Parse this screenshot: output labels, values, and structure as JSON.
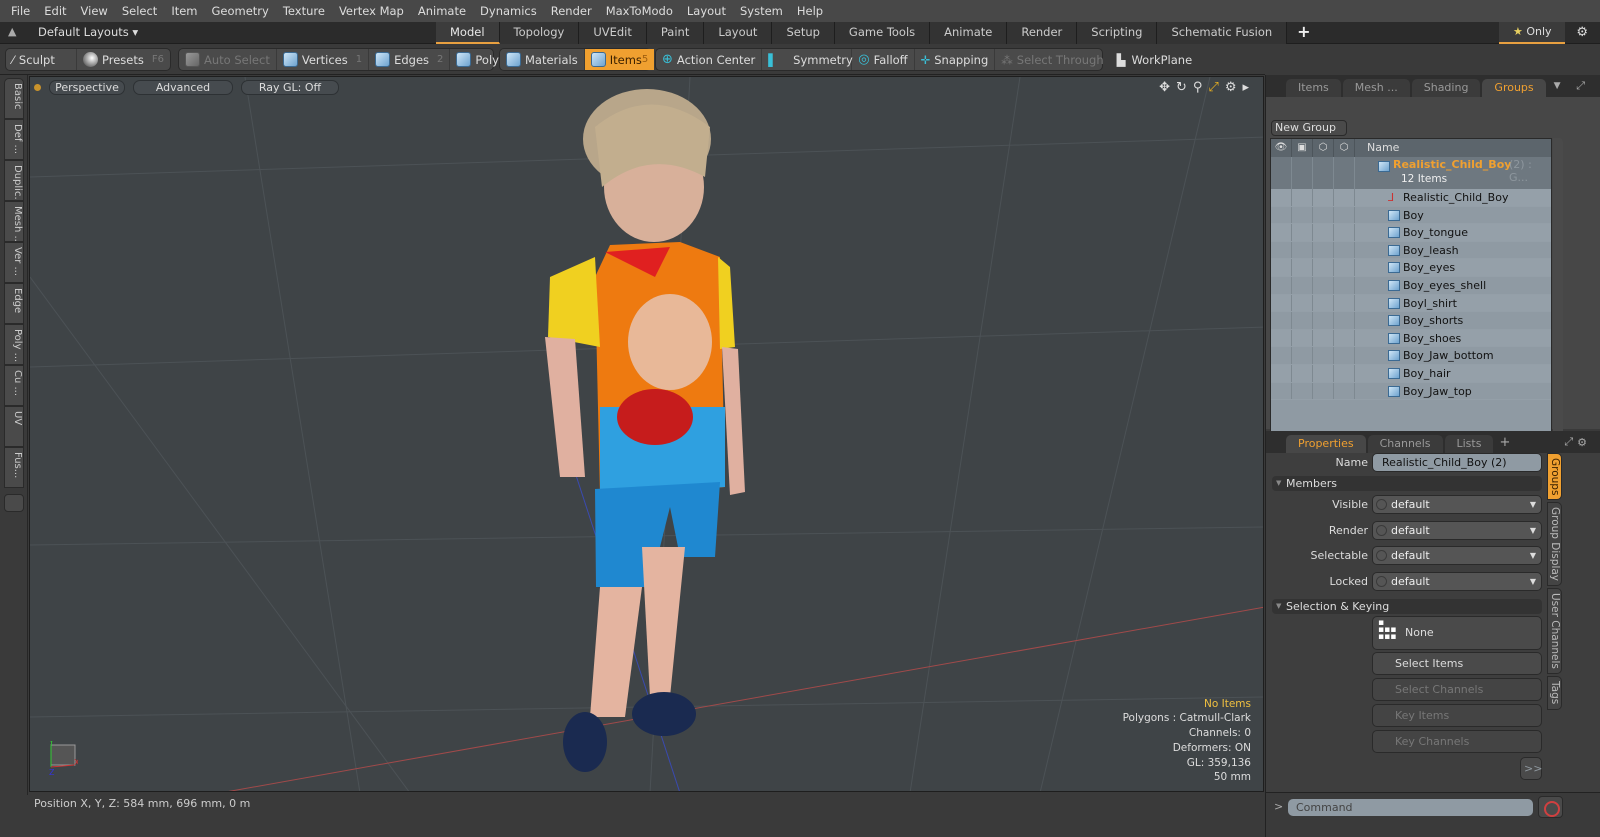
{
  "menu": [
    "File",
    "Edit",
    "View",
    "Select",
    "Item",
    "Geometry",
    "Texture",
    "Vertex Map",
    "Animate",
    "Dynamics",
    "Render",
    "MaxToModo",
    "Layout",
    "System",
    "Help"
  ],
  "layout_bar": {
    "layouts_label": "Default Layouts",
    "tabs": [
      "Model",
      "Topology",
      "UVEdit",
      "Paint",
      "Layout",
      "Setup",
      "Game Tools",
      "Animate",
      "Render",
      "Scripting",
      "Schematic Fusion"
    ],
    "active_tab": "Model",
    "only_label": "Only"
  },
  "toolbar": {
    "sculpt": "Sculpt",
    "presets": "Presets",
    "presets_key": "F6",
    "auto_select": "Auto Select",
    "vertices": "Vertices",
    "vertices_key": "1",
    "edges": "Edges",
    "edges_key": "2",
    "polygons": "Polygons",
    "materials": "Materials",
    "items": "Items",
    "items_key": "5",
    "action_center": "Action Center",
    "symmetry": "Symmetry",
    "falloff": "Falloff",
    "snapping": "Snapping",
    "select_through": "Select Through",
    "workplane": "WorkPlane"
  },
  "left_tabs": [
    "Basic",
    "Def ...",
    "Duplic...",
    "Mesh ...",
    "Ver ...",
    "Edge",
    "Poly ...",
    "Cu ...",
    "UV",
    "Fus..."
  ],
  "viewport": {
    "view_mode": "Perspective",
    "shading": "Advanced",
    "raygl": "Ray GL: Off",
    "info": {
      "selection": "No Items",
      "polygons": "Polygons : Catmull-Clark",
      "channels": "Channels: 0",
      "deformers": "Deformers: ON",
      "gl": "GL: 359,136",
      "scale": "50 mm"
    }
  },
  "status": {
    "position": "Position X, Y, Z:   584 mm, 696 mm, 0 m"
  },
  "groups_panel": {
    "tabs": [
      "Items",
      "Mesh ...",
      "Shading",
      "Groups"
    ],
    "active_tab": "Groups",
    "new_group": "New Group",
    "name_header": "Name",
    "group": {
      "name": "Realistic_Child_Boy",
      "suffix": "(2) : G...",
      "count": "12 Items"
    },
    "items": [
      "Realistic_Child_Boy",
      "Boy",
      "Boy_tongue",
      "Boy_leash",
      "Boy_eyes",
      "Boy_eyes_shell",
      "Boyl_shirt",
      "Boy_shorts",
      "Boy_shoes",
      "Boy_Jaw_bottom",
      "Boy_hair",
      "Boy_Jaw_top"
    ]
  },
  "properties_panel": {
    "tabs": [
      "Properties",
      "Channels",
      "Lists"
    ],
    "active_tab": "Properties",
    "name_label": "Name",
    "name_value": "Realistic_Child_Boy (2)",
    "members_section": "Members",
    "fields": [
      {
        "label": "Visible",
        "value": "default"
      },
      {
        "label": "Render",
        "value": "default"
      },
      {
        "label": "Selectable",
        "value": "default"
      },
      {
        "label": "Locked",
        "value": "default"
      }
    ],
    "selection_section": "Selection & Keying",
    "none_label": "None",
    "select_items": "Select Items",
    "select_channels": "Select Channels",
    "key_items": "Key Items",
    "key_channels": "Key Channels",
    "more": ">>",
    "side_tabs": [
      "Groups",
      "Group Display",
      "User Channels",
      "Tags"
    ]
  },
  "command": {
    "placeholder": "Command"
  },
  "colors": {
    "accent": "#f0a030",
    "group_name": "#f0a030",
    "info_highlight": "#f0c040"
  }
}
